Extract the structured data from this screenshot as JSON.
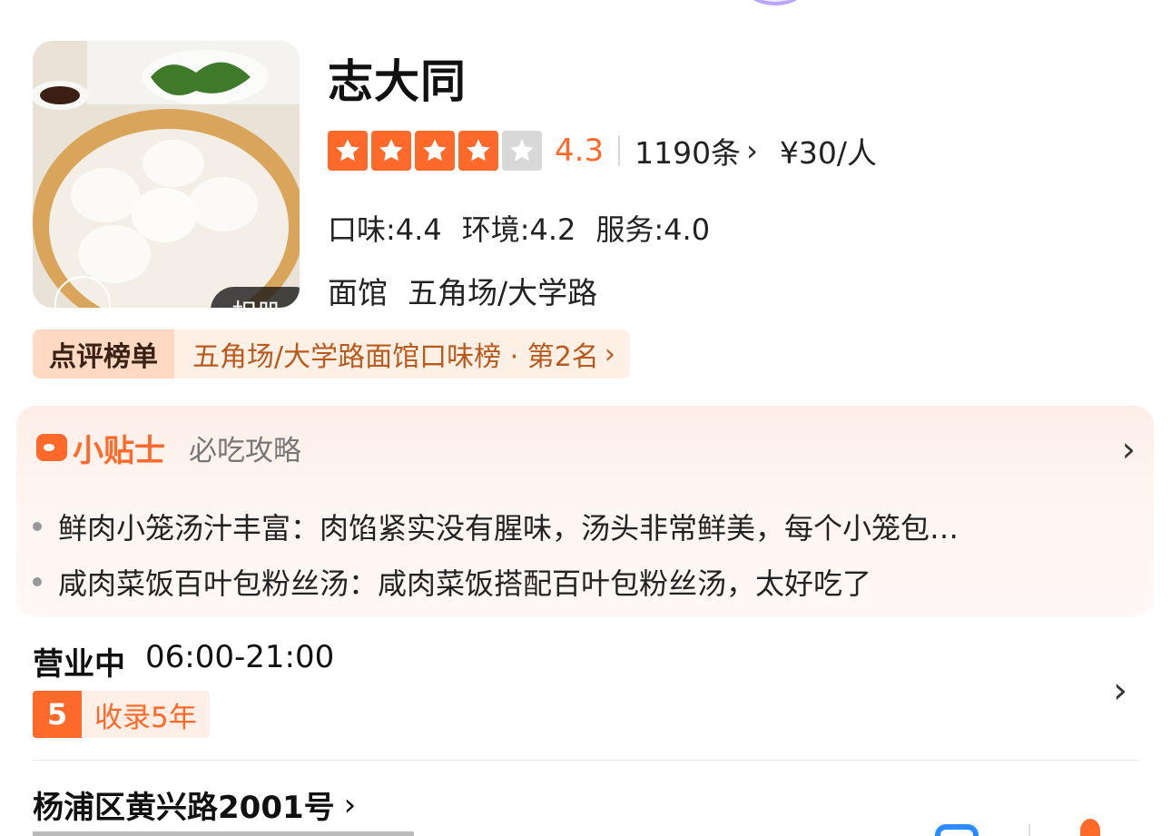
{
  "shop": {
    "name": "志大同",
    "album_label": "相册",
    "rating": {
      "stars_filled": 4,
      "stars_total": 5,
      "score": "4.3",
      "reviews": "1190条",
      "price": "¥30/人"
    },
    "subscores": {
      "taste": "口味:4.4",
      "environment": "环境:4.2",
      "service": "服务:4.0"
    },
    "category": "面馆",
    "area": "五角场/大学路"
  },
  "rank": {
    "tag": "点评榜单",
    "text": "五角场/大学路面馆口味榜 · 第2名"
  },
  "tips": {
    "title": "小贴士",
    "subtitle": "必吃攻略",
    "items": [
      "鲜肉小笼汤汁丰富：肉馅紧实没有腥味，汤头非常鲜美，每个小笼包…",
      "咸肉菜饭百叶包粉丝汤：咸肉菜饭搭配百叶包粉丝汤，太好吃了"
    ]
  },
  "hours": {
    "status": "营业中",
    "time": "06:00-21:00",
    "years_number": "5",
    "years_text": "收录5年"
  },
  "address": {
    "text": "杨浦区黄兴路2001号"
  },
  "colors": {
    "accent": "#ff6a2b",
    "rank_tag_bg": "#ffd9c2",
    "rank_text": "#b85a1e"
  },
  "icons": [
    "chevron-right-icon",
    "star-icon",
    "tips-logo-icon",
    "map-nav-icon",
    "phone-icon"
  ]
}
